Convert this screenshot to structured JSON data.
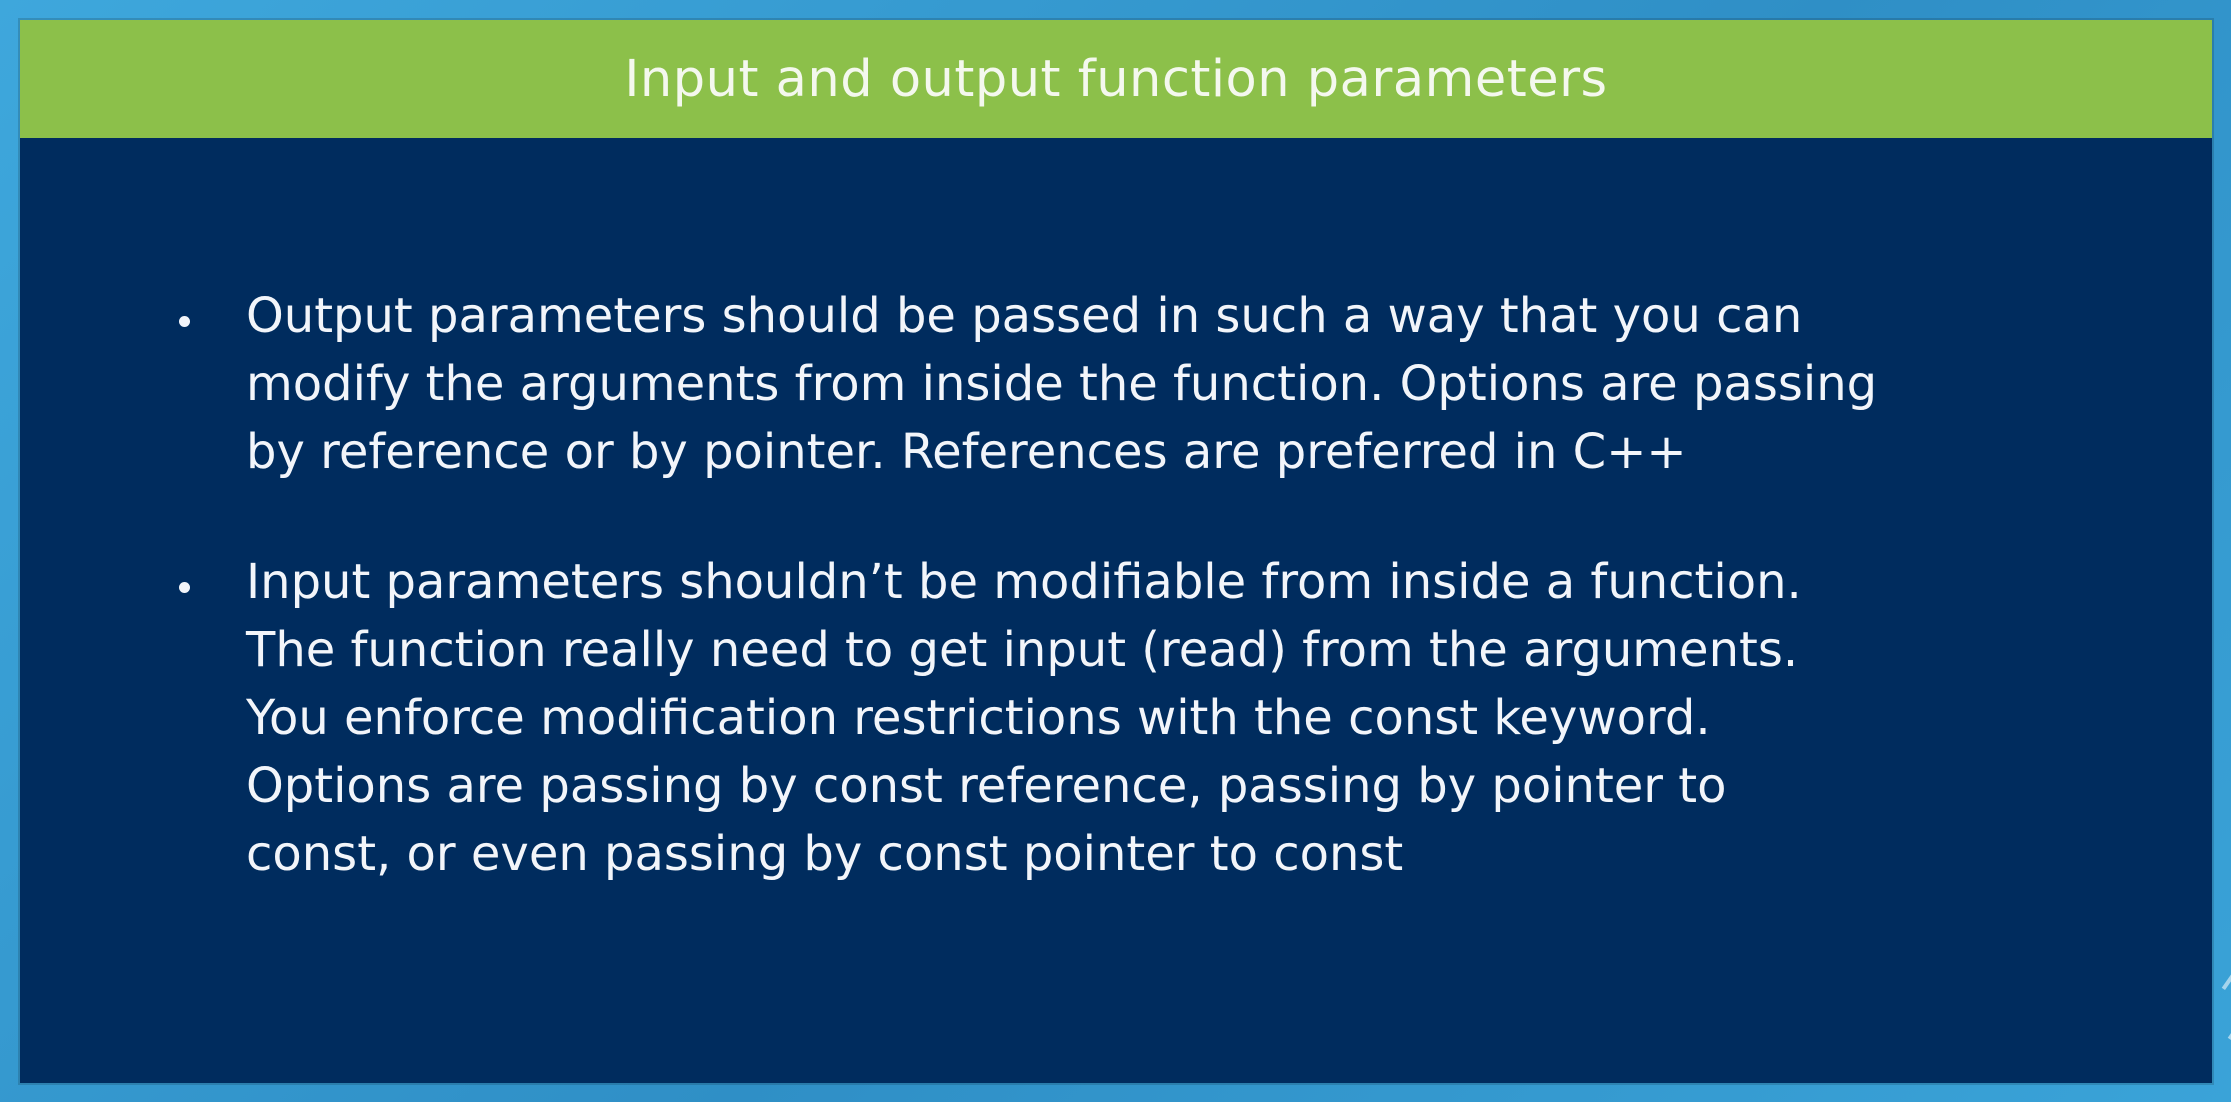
{
  "slide": {
    "title": "Input and output function parameters",
    "bullets": [
      {
        "text": "Output parameters should be passed in such a way that you can\nmodify the arguments from inside the function. Options are passing\nby reference or by pointer. References are preferred in C++"
      },
      {
        "text": "Input parameters shouldn’t be modifiable from inside a function.\nThe function really need to get input (read) from the arguments.\nYou enforce modification restrictions with the const keyword.\nOptions are passing by const reference, passing by pointer to\nconst, or even passing by const pointer to const"
      }
    ]
  },
  "colors": {
    "title_bar": "#8cc04a",
    "slide_background": "#002c5e",
    "frame": "#3aa0d4",
    "text": "#f2f5fa"
  }
}
